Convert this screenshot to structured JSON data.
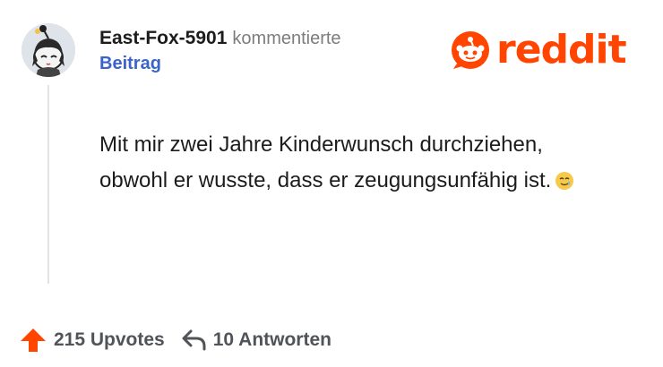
{
  "comment_header": {
    "username": "East-Fox-5901",
    "action": "kommentierte",
    "target": "Beitrag"
  },
  "brand": {
    "name": "reddit",
    "color": "#ff4500"
  },
  "comment": {
    "text": "Mit mir zwei Jahre Kinderwunsch durchziehen, obwohl er wusste, dass er zeugungsunfähig ist.",
    "emoji": "🥲"
  },
  "footer": {
    "upvotes_label": "215 Upvotes",
    "replies_label": "10 Antworten"
  },
  "icons": {
    "avatar": "avatar",
    "upvote": "upvote-arrow-icon",
    "reply": "reply-arrow-icon",
    "logo": "reddit-snoo-icon"
  }
}
